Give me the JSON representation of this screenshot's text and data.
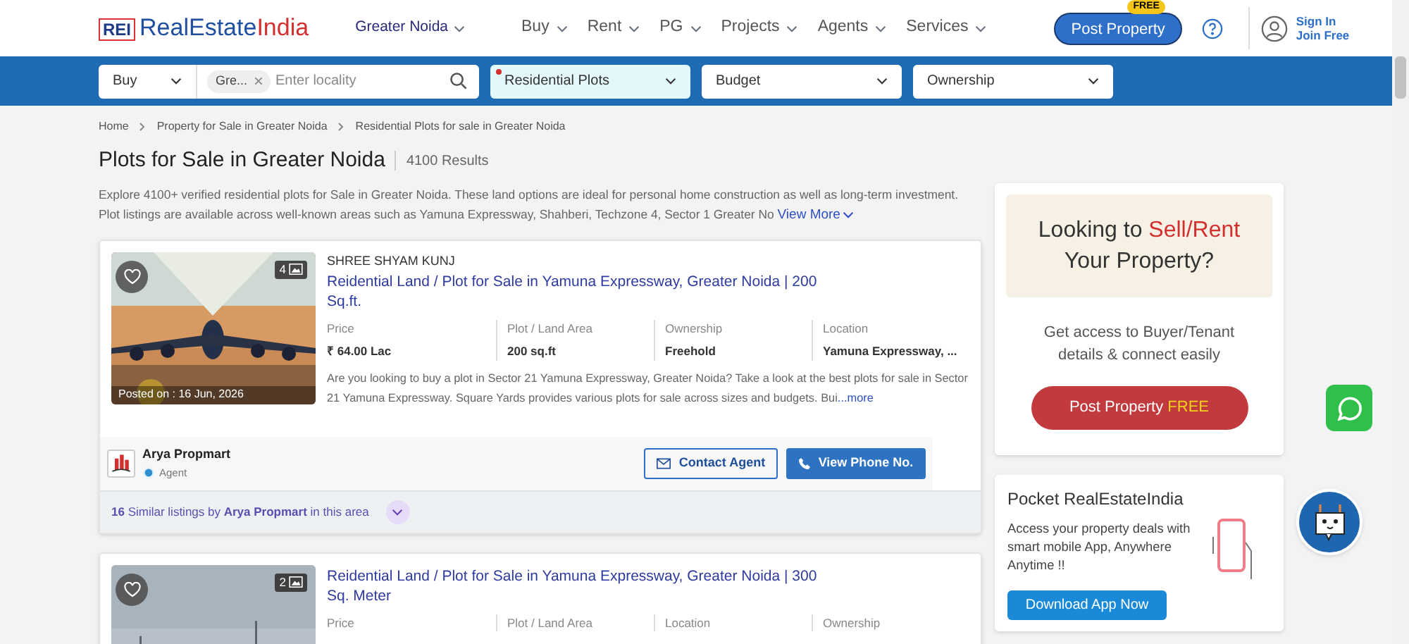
{
  "header": {
    "logo_mark": "REI",
    "logo_first": "RealEstate",
    "logo_second": "India",
    "city": "Greater Noida",
    "nav": [
      "Buy",
      "Rent",
      "PG",
      "Projects",
      "Agents",
      "Services"
    ],
    "post_property": {
      "label": "Post Property",
      "badge": "FREE"
    },
    "sign_in": "Sign In",
    "join_free": "Join Free"
  },
  "search": {
    "transaction": "Buy",
    "chip": "Gre...",
    "placeholder": "Enter locality",
    "property_type": {
      "label": "Residential Plots",
      "active": true
    },
    "budget": "Budget",
    "ownership": "Ownership"
  },
  "breadcrumbs": [
    "Home",
    "Property for Sale in Greater Noida",
    "Residential Plots for sale in Greater Noida"
  ],
  "title": "Plots for Sale in Greater Noida",
  "results": "4100 Results",
  "description": "Explore 4100+ verified residential plots for Sale in Greater Noida. These land options are ideal for personal home construction as well as long-term investment. Plot listings are available across well-known areas such as Yamuna Expressway, Shahberi, Techzone 4, Sector 1 Greater No",
  "view_more": "View More",
  "listings": [
    {
      "project": "SHREE SHYAM KUNJ",
      "title": "Reidential Land / Plot for Sale in Yamuna Expressway, Greater Noida | 200 Sq.ft.",
      "image_count": "4",
      "posted": "Posted on : 16 Jun, 2026",
      "facts": [
        {
          "label": "Price",
          "value": "₹ 64.00 Lac"
        },
        {
          "label": "Plot / Land Area",
          "value": "200 sq.ft"
        },
        {
          "label": "Ownership",
          "value": "Freehold"
        },
        {
          "label": "Location",
          "value": "Yamuna Expressway, ..."
        }
      ],
      "description": "Are you looking to buy a plot in Sector 21 Yamuna Expressway, Greater Noida? Take a look at the best plots for sale in Sector 21 Yamuna Expressway. Square Yards provides various plots for sale across sizes and budgets. Bui",
      "more": "...more",
      "agent": {
        "name": "Arya Propmart",
        "role": "Agent"
      },
      "contact": "Contact Agent",
      "phone": "View Phone No.",
      "similar": "**16** Similar listings by **Arya Propmart** in this area"
    },
    {
      "title": "Reidential Land / Plot for Sale in Yamuna Expressway, Greater Noida | 300 Sq. Meter",
      "image_count": "2",
      "facts": [
        {
          "label": "Price"
        },
        {
          "label": "Plot / Land Area"
        },
        {
          "label": "Location"
        },
        {
          "label": "Ownership"
        }
      ]
    }
  ],
  "promo": {
    "before": "Looking to ",
    "highlight": "Sell/Rent",
    "after": "Your Property?",
    "text": "Get access to Buyer/Tenant details & connect easily",
    "button": "Post Property ",
    "button_highlight": "FREE"
  },
  "app": {
    "title": "Pocket RealEstateIndia",
    "text": "Access your property deals with smart mobile App, Anywhere Anytime !!",
    "button": "Download App Now"
  }
}
